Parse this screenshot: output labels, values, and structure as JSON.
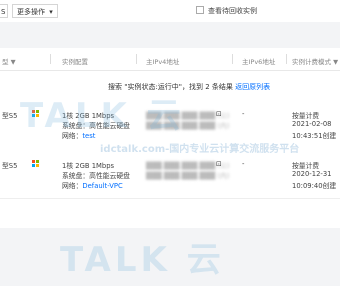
{
  "toolbar": {
    "cut_button_label": "S",
    "more_button_label": "更多操作",
    "show_recycle_label": "查看待回收实例"
  },
  "table": {
    "headers": {
      "type": "型 ▼",
      "config": "实例配置",
      "ipv4": "主IPv4地址",
      "ipv6": "主IPv6地址",
      "billing": "实例计费模式 ▼"
    },
    "banner": {
      "text": "搜索 \"实例状态:运行中\"，找到 2 条结果",
      "link": "返回原列表"
    },
    "rows": [
      {
        "type": "型S5",
        "config_line1": "1核 2GB 1Mbps",
        "config_line2": "系统盘：高性能云硬盘",
        "network_label": "网络：",
        "network_value": "test",
        "ipv4_public": "███.███.███.███ (公)",
        "ipv4_private": "███.███.███.███ (内)",
        "ipv6": "-",
        "billing_line1": "按量计费",
        "billing_line2": "2021-02-08",
        "billing_line3": "10:43:51创建"
      },
      {
        "type": "型S5",
        "config_line1": "1核 2GB 1Mbps",
        "config_line2": "系统盘：高性能云硬盘",
        "network_label": "网络：",
        "network_value": "Default-VPC",
        "ipv4_public": "███.███.███.███ (公)",
        "ipv4_private": "███.███.███.███ (内)",
        "ipv6": "-",
        "billing_line1": "按量计费",
        "billing_line2": "2020-12-31",
        "billing_line3": "10:09:40创建"
      }
    ]
  },
  "watermark": {
    "brand": "TALK 云",
    "url": "idctalk.com-国内专业云计算交流服务平台"
  },
  "colors": {
    "link": "#006eff",
    "win_red": "#f25022",
    "win_green": "#7fba00",
    "win_blue": "#00a4ef",
    "win_yellow": "#ffb900"
  }
}
